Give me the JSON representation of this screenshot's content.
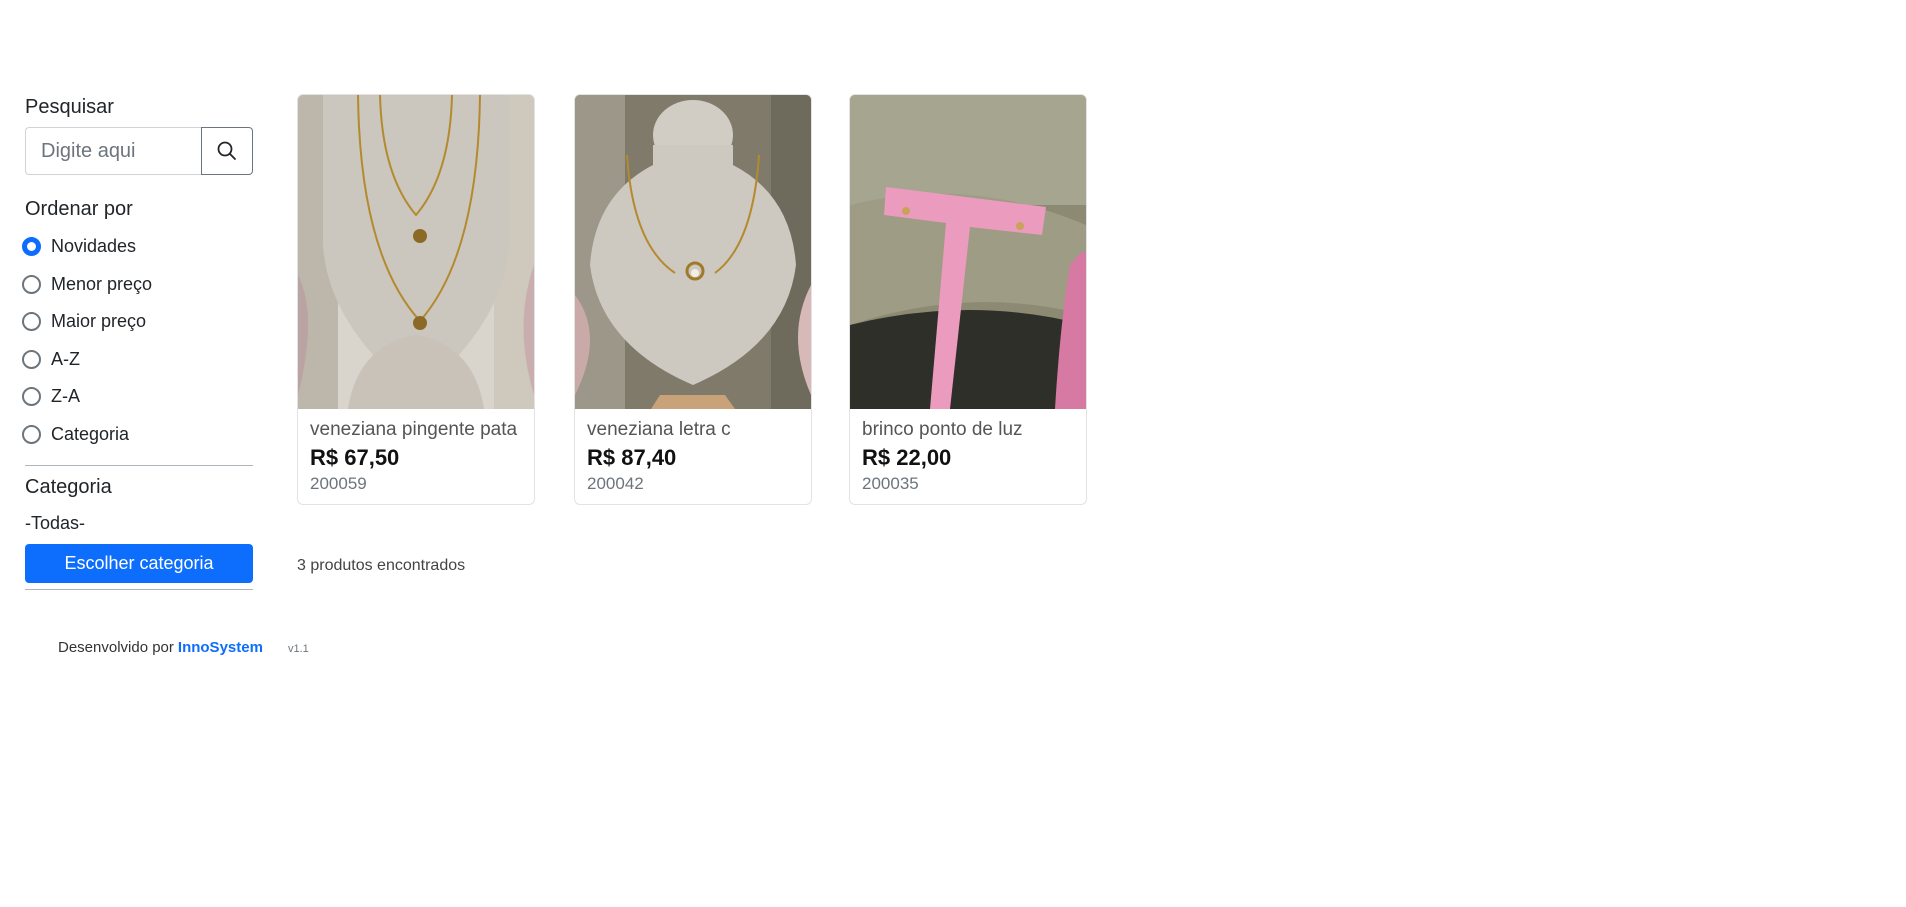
{
  "search": {
    "label": "Pesquisar",
    "placeholder": "Digite aqui",
    "value": ""
  },
  "order": {
    "label": "Ordenar por",
    "options": [
      {
        "label": "Novidades",
        "checked": true
      },
      {
        "label": "Menor preço",
        "checked": false
      },
      {
        "label": "Maior preço",
        "checked": false
      },
      {
        "label": "A-Z",
        "checked": false
      },
      {
        "label": "Z-A",
        "checked": false
      },
      {
        "label": "Categoria",
        "checked": false
      }
    ]
  },
  "category": {
    "label": "Categoria",
    "selected": "-Todas-",
    "button_label": "Escolher categoria"
  },
  "products": [
    {
      "name": "veneziana pingente pata",
      "price": "R$ 67,50",
      "code": "200059",
      "image": "necklace-two-flower-pendants"
    },
    {
      "name": "veneziana letra c",
      "price": "R$ 87,40",
      "code": "200042",
      "image": "necklace-letter-c-pendant"
    },
    {
      "name": "brinco ponto de luz",
      "price": "R$ 22,00",
      "code": "200035",
      "image": "stud-earrings-pink-stand"
    }
  ],
  "results_count": "3 produtos encontrados",
  "footer": {
    "developed_by": "Desenvolvido por",
    "brand": "InnoSystem",
    "version": "v1.1"
  },
  "colors": {
    "primary": "#0d6efd",
    "text": "#212529",
    "muted": "#6c757d"
  },
  "icons": {
    "search_button": "search-icon"
  }
}
